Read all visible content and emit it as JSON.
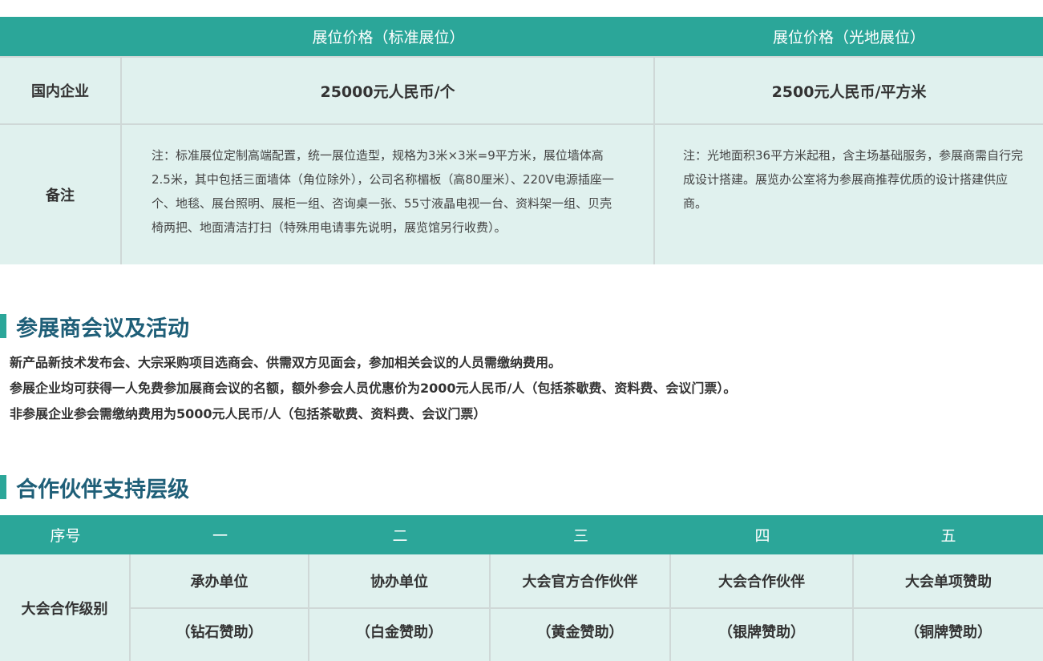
{
  "price_table": {
    "header": [
      "",
      "展位价格（标准展位）",
      "展位价格（光地展位）"
    ],
    "rows": [
      {
        "label": "国内企业",
        "standard": "25000元人民币/个",
        "raw": "2500元人民币/平方米"
      },
      {
        "label": "备注",
        "standard": "注：标准展位定制高端配置，统一展位造型，规格为3米×3米=9平方米，展位墙体高2.5米，其中包括三面墙体（角位除外），公司名称楣板（高80厘米）、220V电源插座一个、地毯、展台照明、展柜一组、咨询桌一张、55寸液晶电视一台、资料架一组、贝壳椅两把、地面清洁打扫（特殊用电请事先说明，展览馆另行收费）。",
        "raw": "注：光地面积36平方米起租，含主场基础服务，参展商需自行完成设计搭建。展览办公室将为参展商推荐优质的设计搭建供应商。"
      }
    ]
  },
  "meetings": {
    "title": "参展商会议及活动",
    "paragraphs": [
      "新产品新技术发布会、大宗采购项目选商会、供需双方见面会，参加相关会议的人员需缴纳费用。",
      "参展企业均可获得一人免费参加展商会议的名额，额外参会人员优惠价为2000元人民币/人（包括茶歇费、资料费、会议门票）。",
      "非参展企业参会需缴纳费用为5000元人民币/人（包括茶歇费、资料费、会议门票）"
    ]
  },
  "partners": {
    "title": "合作伙伴支持层级",
    "header": [
      "序号",
      "一",
      "二",
      "三",
      "四",
      "五"
    ],
    "row_label": "大会合作级别",
    "tiers": [
      {
        "name": "承办单位",
        "sub": "（钻石赞助）"
      },
      {
        "name": "协办单位",
        "sub": "（白金赞助）"
      },
      {
        "name": "大会官方合作伙伴",
        "sub": "（黄金赞助）"
      },
      {
        "name": "大会合作伙伴",
        "sub": "（银牌赞助）"
      },
      {
        "name": "大会单项赞助",
        "sub": "（铜牌赞助）"
      }
    ]
  },
  "colors": {
    "accent": "#2ba699",
    "cell_bg": "#e0f1ee",
    "heading": "#1f5f78"
  }
}
